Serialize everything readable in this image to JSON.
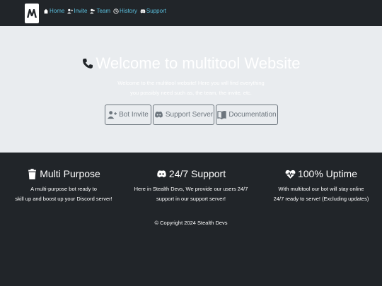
{
  "nav": {
    "items": [
      {
        "label": "Home",
        "icon": "home-icon"
      },
      {
        "label": "Invite",
        "icon": "user-plus-icon"
      },
      {
        "label": "Team",
        "icon": "users-icon"
      },
      {
        "label": "History",
        "icon": "clock-icon"
      },
      {
        "label": "Support",
        "icon": "discord-icon"
      }
    ],
    "link_color": "#5bc0de"
  },
  "hero": {
    "title": "Welcome to multitool Website",
    "desc_line1": "Welcome to the multitool website! Here you will find everything",
    "desc_line2": "you possibly need such as, the team, the invite, etc.",
    "buttons": [
      {
        "label": "Bot Invite",
        "icon": "user-plus-icon"
      },
      {
        "label": "Support Server",
        "icon": "discord-icon"
      },
      {
        "label": "Documentation",
        "icon": "book-icon"
      }
    ],
    "background": "#e9ecef"
  },
  "features": [
    {
      "title": "Multi Purpose",
      "icon": "trash-icon",
      "line1": "A multi-purpose bot ready to",
      "line2": "skill up and boost up your Discord server!"
    },
    {
      "title": "24/7 Support",
      "icon": "discord-icon",
      "line1": "Here in Stealth Devs, We provide our users 24/7",
      "line2": "support in our support server!"
    },
    {
      "title": "100% Uptime",
      "icon": "heart-pulse-icon",
      "line1": "With multitool our bot will stay online",
      "line2": "24/7 ready to serve! (Excluding updates)"
    }
  ],
  "footer": {
    "copyright": "© Copyright 2024 Stealth Devs"
  },
  "colors": {
    "page_background": "#212529",
    "button_outline": "#6c757d"
  }
}
